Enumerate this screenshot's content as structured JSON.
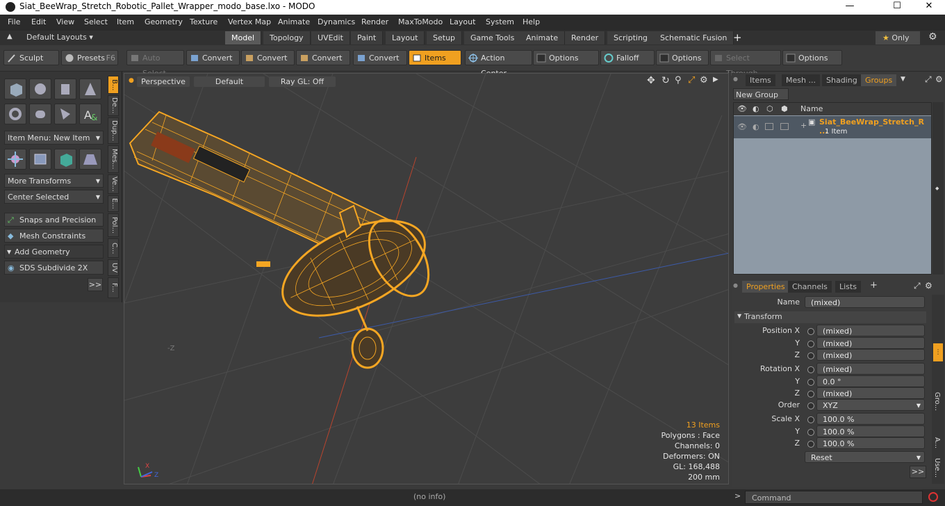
{
  "window": {
    "title": "Siat_BeeWrap_Stretch_Robotic_Pallet_Wrapper_modo_base.lxo - MODO",
    "min": "—",
    "max": "☐",
    "close": "✕"
  },
  "menu": [
    "File",
    "Edit",
    "View",
    "Select",
    "Item",
    "Geometry",
    "Texture",
    "Vertex Map",
    "Animate",
    "Dynamics",
    "Render",
    "MaxToModo",
    "Layout",
    "System",
    "Help"
  ],
  "tabbar": {
    "layouts": "Default Layouts",
    "tabs": [
      "Model",
      "Topology",
      "UVEdit",
      "Paint",
      "Layout",
      "Setup",
      "Game Tools",
      "Animate",
      "Render",
      "Scripting",
      "Schematic Fusion"
    ],
    "active": "Model",
    "add": "+",
    "only": "Only"
  },
  "toolbar": {
    "sculpt": "Sculpt",
    "presets": "Presets",
    "presets_key": "F6",
    "auto_select": "Auto Select",
    "convert": "Convert",
    "items": "Items",
    "action_center": "Action Center",
    "options": "Options",
    "falloff": "Falloff",
    "select_through": "Select Through"
  },
  "left": {
    "item_menu": "Item Menu: New Item",
    "more_transforms": "More Transforms",
    "center_selected": "Center Selected",
    "snaps": "Snaps and Precision",
    "mesh_constraints": "Mesh Constraints",
    "add_geometry": "Add Geometry",
    "sds": "SDS Subdivide 2X",
    "more": ">>",
    "vtabs": [
      "B...",
      "De...",
      "Dup...",
      "Mes...",
      "Ve...",
      "E...",
      "Pol...",
      "C...",
      "UV",
      "F..."
    ]
  },
  "viewport": {
    "perspective": "Perspective",
    "shading": "Default",
    "raygl": "Ray GL: Off",
    "stats": {
      "items": "13 Items",
      "polygons": "Polygons : Face",
      "channels": "Channels: 0",
      "deformers": "Deformers: ON",
      "gl": "GL: 168,488",
      "scale": "200 mm"
    },
    "axis_neg_z": "-Z",
    "axis_x": "X",
    "axis_z": "Z"
  },
  "groups_panel": {
    "tabs": [
      "Items",
      "Mesh ...",
      "Shading",
      "Groups"
    ],
    "active": "Groups",
    "new_group": "New Group",
    "col_name": "Name",
    "row_name": "Siat_BeeWrap_Stretch_R ...",
    "row_sub": "1 Item"
  },
  "properties": {
    "tabs": [
      "Properties",
      "Channels",
      "Lists"
    ],
    "active": "Properties",
    "add": "+",
    "name_label": "Name",
    "name_value": "(mixed)",
    "transform": "Transform",
    "position_x_label": "Position X",
    "rotation_x_label": "Rotation X",
    "scale_x_label": "Scale X",
    "y_label": "Y",
    "z_label": "Z",
    "pos_x": "(mixed)",
    "pos_y": "(mixed)",
    "pos_z": "(mixed)",
    "rot_x": "(mixed)",
    "rot_y": "0.0 °",
    "rot_z": "(mixed)",
    "order_label": "Order",
    "order_value": "XYZ",
    "scale_x": "100.0 %",
    "scale_y": "100.0 %",
    "scale_z": "100.0 %",
    "reset": "Reset",
    "more": ">>",
    "side_tabs": [
      "Gro...",
      "A...",
      "Use..."
    ]
  },
  "status": {
    "info": "(no info)",
    "command": "Command",
    "prompt": ">"
  },
  "colors": {
    "accent": "#f0a020",
    "wire": "#f5a623"
  }
}
